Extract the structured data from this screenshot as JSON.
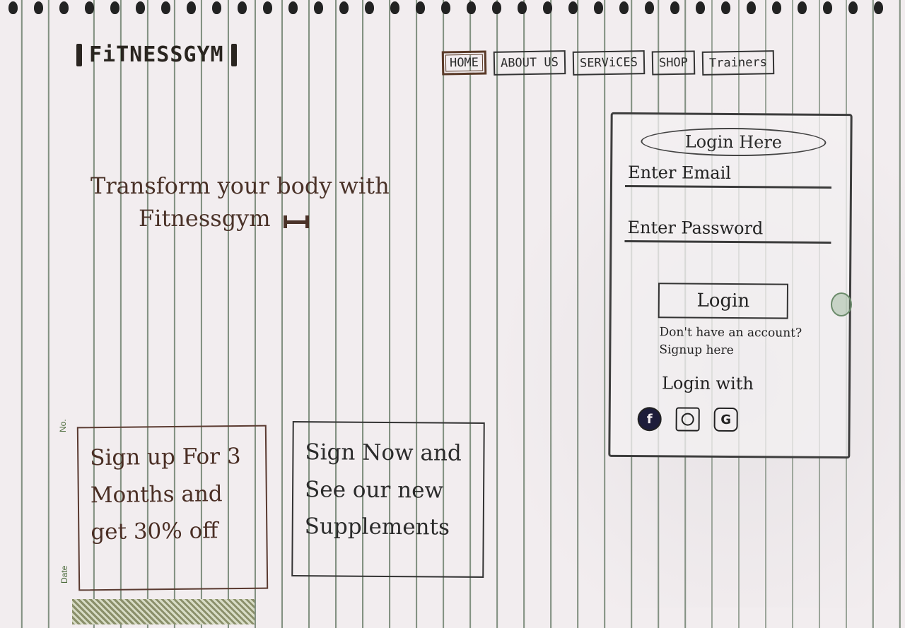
{
  "brand": {
    "name": "FiTNESSGYM"
  },
  "nav": {
    "items": [
      {
        "label": "HOME",
        "active": true
      },
      {
        "label": "ABOUT US",
        "active": false
      },
      {
        "label": "SERViCES",
        "active": false
      },
      {
        "label": "SHOP",
        "active": false
      },
      {
        "label": "Trainers",
        "active": false
      }
    ]
  },
  "hero": {
    "line1": "Transform your body with",
    "line2": "Fitnessgym"
  },
  "login": {
    "title": "Login Here",
    "email_placeholder": "Enter Email",
    "password_placeholder": "Enter Password",
    "button_label": "Login",
    "no_account_text": "Don't have an account?",
    "signup_link": "Signup here",
    "login_with_label": "Login with",
    "social": [
      {
        "name": "facebook",
        "glyph": "f"
      },
      {
        "name": "instagram",
        "glyph": ""
      },
      {
        "name": "google",
        "glyph": "G"
      }
    ]
  },
  "promos": [
    {
      "text": "Sign up For 3 Months and get 30% off"
    },
    {
      "text": "Sign Now and See our new Supplements"
    }
  ],
  "paper": {
    "margin_no_label": "No.",
    "margin_date_label": "Date",
    "line_color": "#3c5a3c"
  }
}
